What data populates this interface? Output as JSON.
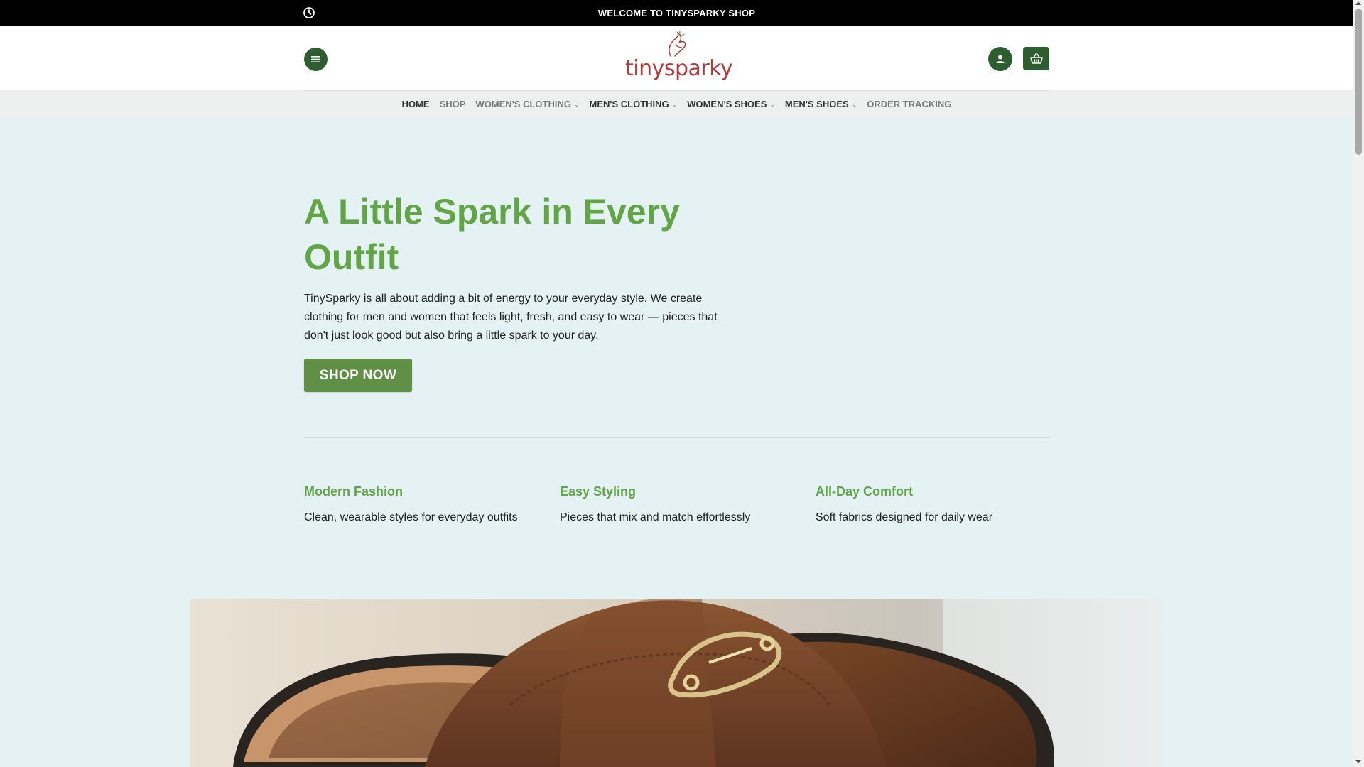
{
  "topbar": {
    "welcome": "WELCOME TO TINYSPARKY SHOP",
    "clock_icon": "clock-icon"
  },
  "header": {
    "logo_text": "tinysparky",
    "menu_icon": "hamburger-icon",
    "account_icon": "user-icon",
    "cart_icon": "basket-icon"
  },
  "nav": {
    "items": [
      {
        "label": "HOME"
      },
      {
        "label": "SHOP"
      },
      {
        "label": "WOMEN'S CLOTHING"
      },
      {
        "label": "MEN'S CLOTHING"
      },
      {
        "label": "WOMEN'S SHOES"
      },
      {
        "label": "MEN'S SHOES"
      },
      {
        "label": "ORDER TRACKING"
      }
    ]
  },
  "hero": {
    "title_line1": "A Little Spark in Every",
    "title_line2": "Outfit",
    "text": "TinySparky is all about adding a bit of energy to your everyday style. We create clothing for men and women that feels light, fresh, and easy to wear — pieces that don't just look good but also bring a little spark to your day.",
    "cta": "SHOP NOW"
  },
  "features": [
    {
      "title": "Modern Fashion",
      "text": "Clean, wearable styles for everyday outfits"
    },
    {
      "title": "Easy Styling",
      "text": "Pieces that mix and match effortlessly"
    },
    {
      "title": "All-Day Comfort",
      "text": "Soft fabrics designed for daily wear"
    }
  ],
  "colors": {
    "accent_green": "#62a547",
    "button_green": "#5f9046",
    "dark_green": "#2e5e30",
    "logo_red": "#b23a3a",
    "hero_bg": "#e4f2f4"
  }
}
